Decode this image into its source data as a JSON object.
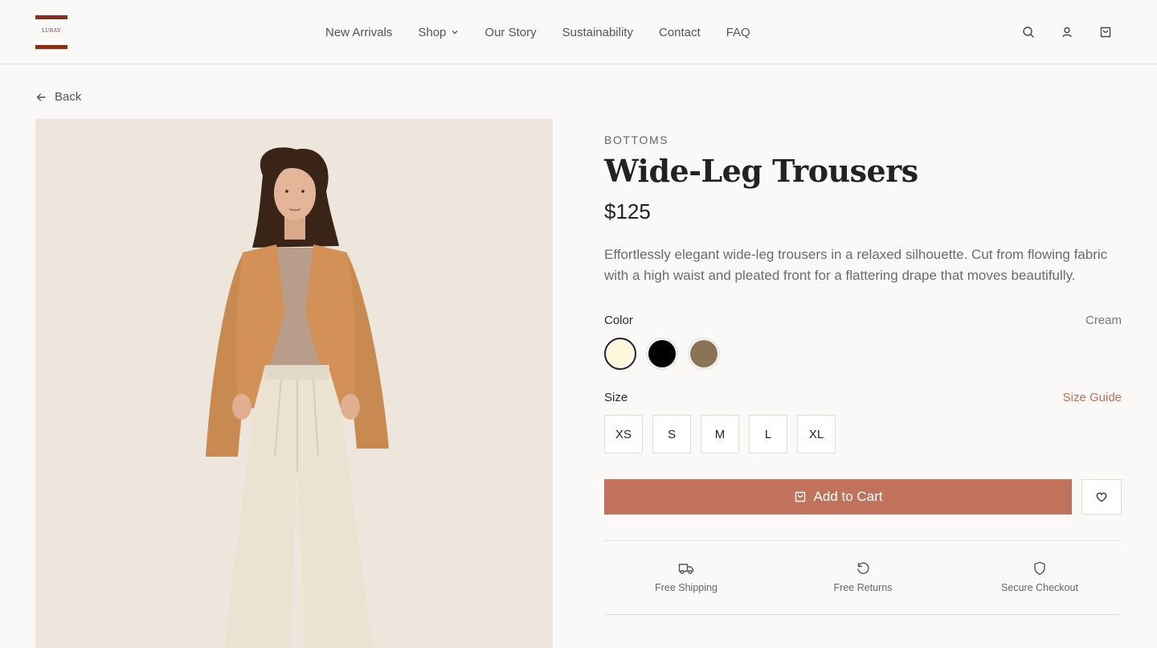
{
  "brand": {
    "logo_text": "LURAV",
    "color": "#8b2f1b"
  },
  "nav": {
    "items": [
      {
        "label": "New Arrivals"
      },
      {
        "label": "Shop",
        "has_dropdown": true
      },
      {
        "label": "Our Story"
      },
      {
        "label": "Sustainability"
      },
      {
        "label": "Contact"
      },
      {
        "label": "FAQ"
      }
    ],
    "icons": [
      "search-icon",
      "user-icon",
      "cart-icon"
    ]
  },
  "back_label": "Back",
  "product": {
    "category": "BOTTOMS",
    "title": "Wide-Leg Trousers",
    "price": "$125",
    "description": "Effortlessly elegant wide-leg trousers in a relaxed silhouette. Cut from flowing fabric with a high waist and pleated front for a flattering drape that moves beautifully.",
    "image": "model wearing cream wide-leg trousers, camel blazer and taupe top",
    "color_label": "Color",
    "selected_color": "Cream",
    "colors": [
      {
        "name": "Cream",
        "hex": "#fdf8d9",
        "selected": true
      },
      {
        "name": "Black",
        "hex": "#000000",
        "selected": false
      },
      {
        "name": "Taupe",
        "hex": "#8b7355",
        "selected": false
      }
    ],
    "size_label": "Size",
    "size_guide_label": "Size Guide",
    "sizes": [
      "XS",
      "S",
      "M",
      "L",
      "XL"
    ],
    "add_to_cart_label": "Add to Cart",
    "accent": "#c1725c"
  },
  "perks": [
    {
      "icon": "truck-icon",
      "label": "Free Shipping"
    },
    {
      "icon": "return-icon",
      "label": "Free Returns"
    },
    {
      "icon": "shield-icon",
      "label": "Secure Checkout"
    }
  ]
}
